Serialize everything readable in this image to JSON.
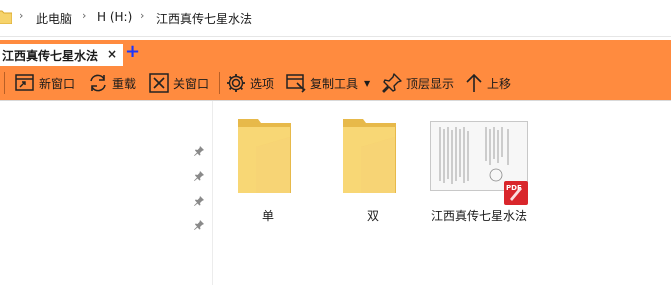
{
  "address_bar": {
    "breadcrumbs": [
      "此电脑",
      "H (H:)",
      "江西真传七星水法"
    ],
    "folder_icon": "folder-icon",
    "separator_icon": "chevron-right-icon"
  },
  "tabs": {
    "active_label": "江西真传七星水法",
    "close_symbol": "×",
    "add_symbol": "+"
  },
  "toolbar": {
    "new_window": "新窗口",
    "reload": "重载",
    "close_window": "关窗口",
    "options": "选项",
    "copy_tool": "复制工具",
    "top_display": "顶层显示",
    "up": "上移"
  },
  "files": [
    {
      "name": "单",
      "type": "folder",
      "icon": "folder-icon"
    },
    {
      "name": "双",
      "type": "folder",
      "icon": "folder-icon"
    },
    {
      "name": "江西真传七星水法",
      "type": "pdf",
      "icon": "pdf-icon",
      "badge": "PDF"
    }
  ],
  "colors": {
    "accent": "#ff8b3f",
    "folder": "#f6d36b",
    "pdf": "#d9262b",
    "add_tab": "#1a35ff"
  }
}
